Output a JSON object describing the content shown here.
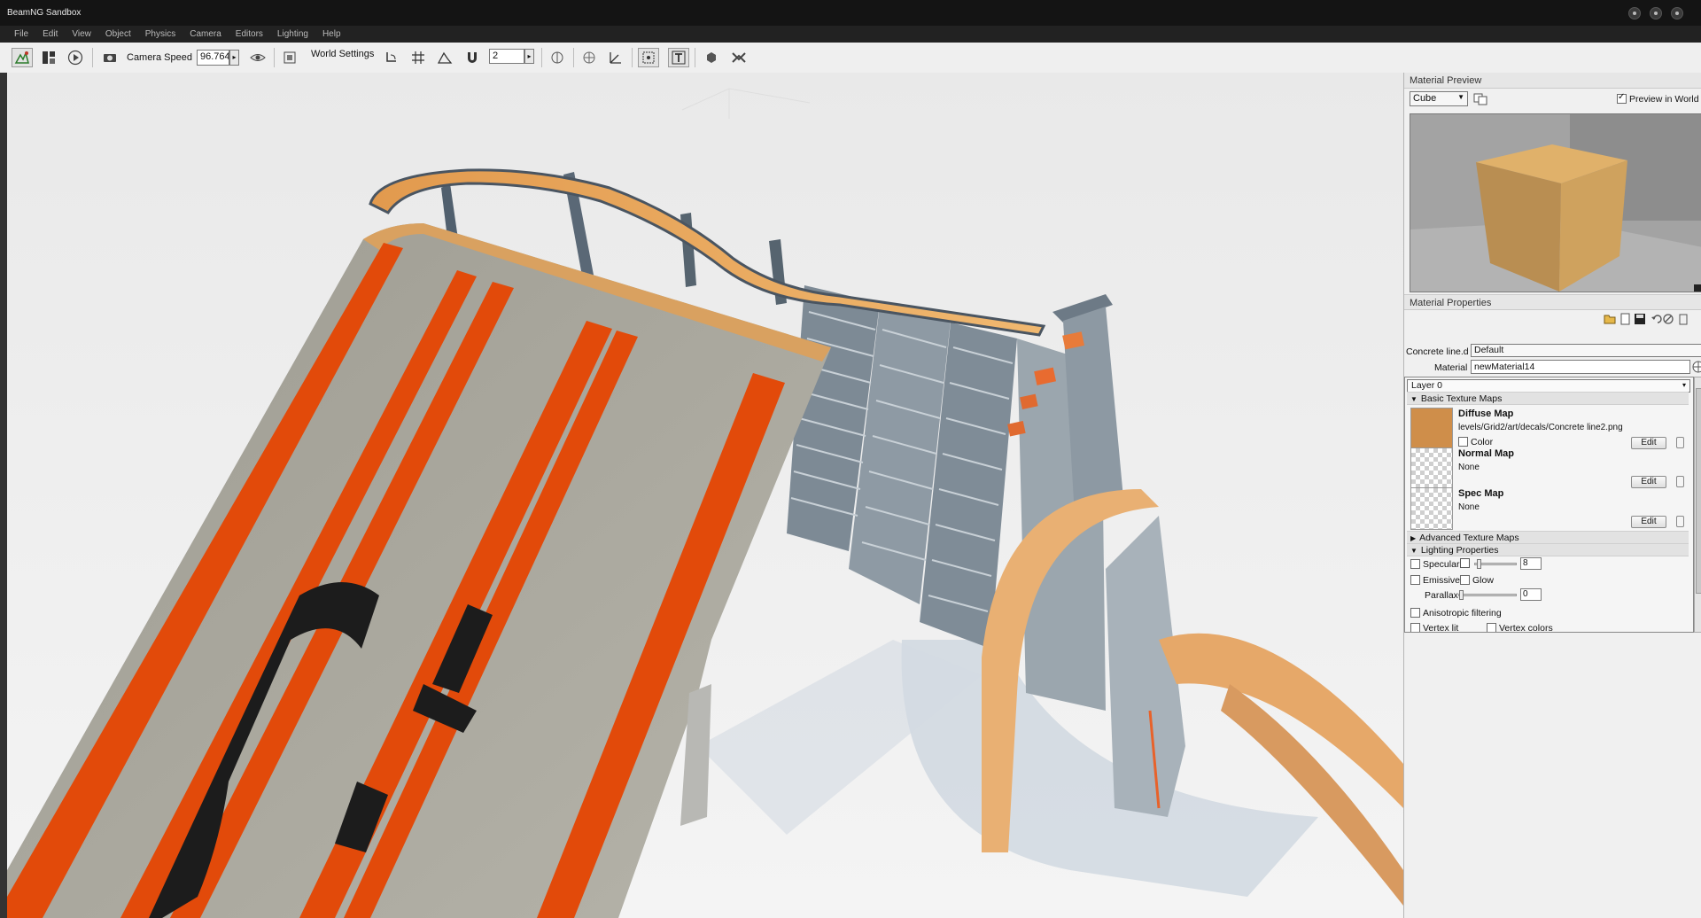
{
  "window": {
    "title": "BeamNG Sandbox"
  },
  "menu": [
    "File",
    "Edit",
    "View",
    "Object",
    "Physics",
    "Camera",
    "Editors",
    "Lighting",
    "Help"
  ],
  "toolbar": {
    "camera_speed_label": "Camera Speed",
    "camera_speed_value": "96.764",
    "world_settings_label": "World Settings",
    "grid_value": "2"
  },
  "material_preview": {
    "header": "Material Preview",
    "shape_select": "Cube",
    "preview_in_world_label": "Preview in World",
    "preview_in_world_checked": true
  },
  "material_properties": {
    "header": "Material Properties",
    "mapto_label": "Concrete line.d",
    "mapto_value": "Default",
    "material_label": "Material",
    "material_value": "newMaterial14",
    "layer_value": "Layer 0",
    "basic_texture_maps": "Basic Texture Maps",
    "diffuse": {
      "name": "Diffuse Map",
      "path": "levels/Grid2/art/decals/Concrete line2.png",
      "color_label": "Color",
      "edit_label": "Edit",
      "swatch_color": "#cf8e4a"
    },
    "normal": {
      "name": "Normal Map",
      "path": "None",
      "edit_label": "Edit"
    },
    "spec": {
      "name": "Spec Map",
      "path": "None",
      "edit_label": "Edit"
    },
    "advanced_texture_maps": "Advanced Texture Maps",
    "lighting_properties": "Lighting Properties",
    "specular_label": "Specular",
    "specular_power": "8",
    "emissive_label": "Emissive",
    "glow_label": "Glow",
    "parallax_label": "Parallax",
    "parallax_value": "0",
    "anisotropic_label": "Anisotropic filtering",
    "vertex_lit_label": "Vertex lit",
    "vertex_colors_label": "Vertex colors"
  },
  "colors": {
    "track_orange": "#e24a0a",
    "track_concrete": "#a6a49a",
    "rail_orange": "#e8a256",
    "background": "#ececec"
  }
}
